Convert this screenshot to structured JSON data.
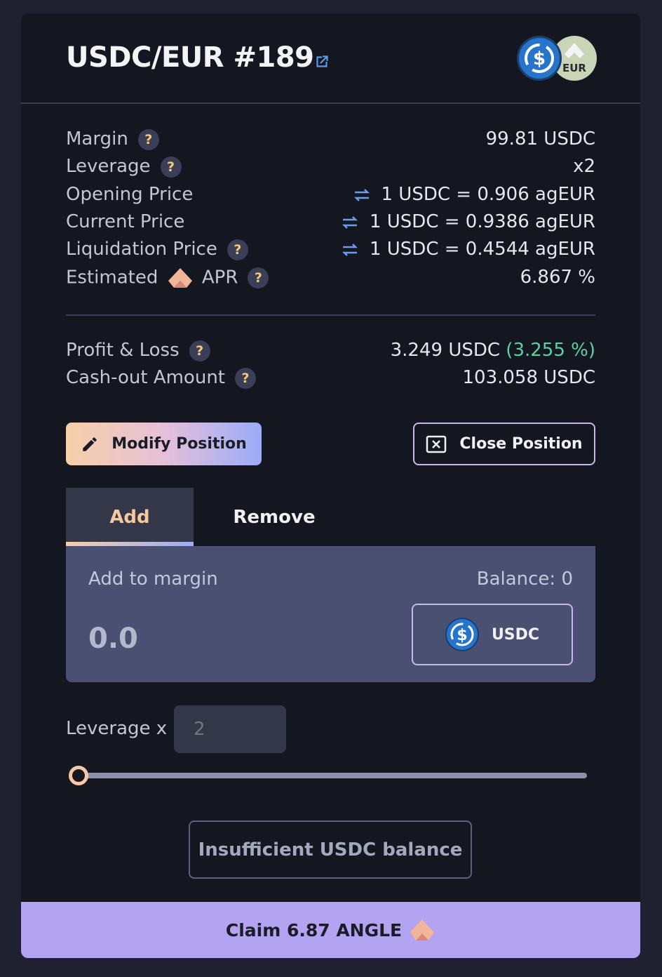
{
  "header": {
    "title": "USDC/EUR #189",
    "external_link_icon": "external-link-icon",
    "token_icons": [
      "usdc-coin-icon",
      "eur-coin-icon"
    ],
    "eur_badge_text": "EUR"
  },
  "details": {
    "margin": {
      "label": "Margin",
      "value": "99.81 USDC"
    },
    "leverage": {
      "label": "Leverage",
      "value": "x2"
    },
    "opening_price": {
      "label": "Opening Price",
      "value": "1 USDC = 0.906 agEUR"
    },
    "current_price": {
      "label": "Current Price",
      "value": "1 USDC = 0.9386 agEUR"
    },
    "liquidation_price": {
      "label": "Liquidation Price",
      "value": "1 USDC = 0.4544 agEUR"
    },
    "apr": {
      "label_before": "Estimated",
      "label_after": "APR",
      "value": "6.867 %"
    }
  },
  "pnl": {
    "profit_loss": {
      "label": "Profit & Loss",
      "value": "3.249 USDC",
      "percent": "(3.255 %)"
    },
    "cashout": {
      "label": "Cash-out Amount",
      "value": "103.058 USDC"
    }
  },
  "actions": {
    "modify_label": "Modify Position",
    "close_label": "Close Position"
  },
  "tabs": {
    "add": "Add",
    "remove": "Remove",
    "active": "Add"
  },
  "margin_panel": {
    "label": "Add to margin",
    "balance": "Balance: 0",
    "amount_placeholder": "0.0",
    "token": "USDC"
  },
  "leverage_control": {
    "label": "Leverage x",
    "placeholder": "2",
    "slider_fraction": 0
  },
  "submit": {
    "label": "Insufficient USDC balance"
  },
  "claim": {
    "label": "Claim 6.87 ANGLE"
  },
  "help_glyph": "?",
  "colors": {
    "background": "#1f2130",
    "card": "#141620",
    "panel": "#4a5071",
    "accent_green": "#5fcfa6",
    "help_text": "#f5c87a",
    "claim_bar": "#b3a3f0",
    "usdc_blue": "#2775ca"
  }
}
